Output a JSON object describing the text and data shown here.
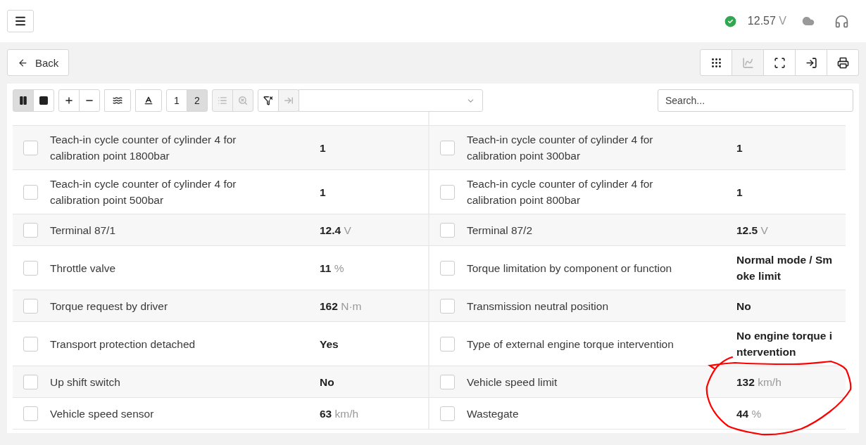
{
  "header": {
    "voltage": "12.57",
    "voltage_unit": "V"
  },
  "back_button": {
    "label": "Back"
  },
  "view_buttons": [
    {
      "kind": "grid",
      "disabled": false
    },
    {
      "kind": "chart",
      "disabled": true
    },
    {
      "kind": "frame",
      "disabled": false
    },
    {
      "kind": "import",
      "disabled": false
    },
    {
      "kind": "print",
      "disabled": false
    }
  ],
  "toolbar": {
    "groups": [
      [
        {
          "kind": "pause",
          "selected": true,
          "disabled": false
        },
        {
          "kind": "stop",
          "selected": false,
          "disabled": false
        }
      ],
      [
        {
          "kind": "plus",
          "selected": false,
          "disabled": false
        },
        {
          "kind": "minus",
          "selected": false,
          "disabled": false
        }
      ],
      [
        {
          "kind": "approx",
          "selected": false,
          "disabled": false
        }
      ],
      [
        {
          "kind": "text-height",
          "selected": false,
          "disabled": false
        }
      ],
      [
        {
          "kind": "page",
          "label": "1",
          "selected": false,
          "disabled": false
        },
        {
          "kind": "page",
          "label": "2",
          "selected": true,
          "disabled": false
        }
      ],
      [
        {
          "kind": "list",
          "selected": false,
          "disabled": true
        },
        {
          "kind": "zoom-clear",
          "selected": false,
          "disabled": true
        }
      ],
      [
        {
          "kind": "filter-clear",
          "selected": false,
          "disabled": false
        },
        {
          "kind": "send",
          "selected": false,
          "disabled": true
        }
      ]
    ],
    "search": {
      "placeholder": "Search..."
    }
  },
  "rows": [
    {
      "cells": [
        {
          "label": "Teach-in cycle counter of cylinder 4 for calibration point 1800bar",
          "value": "1",
          "checked": false
        },
        {
          "label": "Teach-in cycle counter of cylinder 4 for calibration point 300bar",
          "value": "1",
          "checked": false
        }
      ]
    },
    {
      "cells": [
        {
          "label": "Teach-in cycle counter of cylinder 4 for calibration point 500bar",
          "value": "1",
          "checked": false
        },
        {
          "label": "Teach-in cycle counter of cylinder 4 for calibration point 800bar",
          "value": "1",
          "checked": false
        }
      ]
    },
    {
      "cells": [
        {
          "label": "Terminal 87/1",
          "value": "12.4",
          "unit": "V",
          "checked": false
        },
        {
          "label": "Terminal 87/2",
          "value": "12.5",
          "unit": "V",
          "checked": false
        }
      ]
    },
    {
      "cells": [
        {
          "label": "Throttle valve",
          "value": "11",
          "unit": "%",
          "checked": false
        },
        {
          "label": "Torque limitation by component or function",
          "value": "Normal mode / Smoke limit",
          "checked": false
        }
      ]
    },
    {
      "cells": [
        {
          "label": "Torque request by driver",
          "value": "162",
          "unit": "N·m",
          "checked": false
        },
        {
          "label": "Transmission neutral position",
          "value": "No",
          "checked": false
        }
      ]
    },
    {
      "cells": [
        {
          "label": "Transport protection detached",
          "value": "Yes",
          "checked": false
        },
        {
          "label": "Type of external engine torque intervention",
          "value": "No engine torque intervention",
          "checked": false
        }
      ]
    },
    {
      "cells": [
        {
          "label": "Up shift switch",
          "value": "No",
          "checked": false
        },
        {
          "label": "Vehicle speed limit",
          "value": "132",
          "unit": "km/h",
          "checked": false
        }
      ]
    },
    {
      "cells": [
        {
          "label": "Vehicle speed sensor",
          "value": "63",
          "unit": "km/h",
          "checked": false
        },
        {
          "label": "Wastegate",
          "value": "44",
          "unit": "%",
          "checked": false
        }
      ]
    }
  ]
}
